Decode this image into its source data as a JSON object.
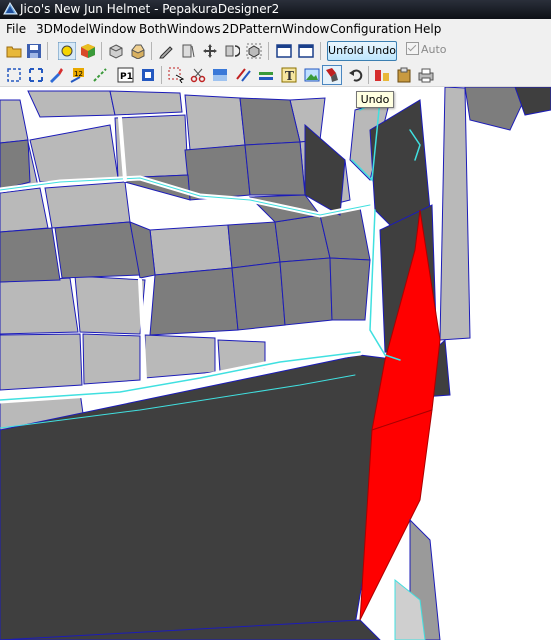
{
  "window": {
    "title": "Jico's New Jun Helmet - PepakuraDesigner2"
  },
  "menu": [
    "File",
    "3DModelWindow",
    "BothWindows",
    "2DPatternWindow",
    "Configuration",
    "Help"
  ],
  "toolbar": {
    "unfold_undo_label": "Unfold Undo",
    "auto_label": "Auto",
    "auto_checked": true
  },
  "tooltip": {
    "text": "Undo"
  },
  "colors": {
    "face_light": "#b9b9b9",
    "face_mid": "#7d7d7d",
    "face_dark": "#3f3f3f",
    "edge_blue": "#1c1cb8",
    "edge_cyan": "#40e0e0",
    "highlight_red": "#ff0000"
  },
  "icons": {
    "toolbar_row1": [
      "open-icon",
      "save-icon",
      "view-3d-icon",
      "color-cube-icon",
      "box-icon",
      "box-open-icon",
      "pencil-icon",
      "crop-icon",
      "move-icon",
      "rotate-icon",
      "cube-select-icon",
      "window-single-icon",
      "window-split-icon"
    ],
    "toolbar_row2": [
      "select-rect-icon",
      "fit-icon",
      "paint-icon",
      "number-icon",
      "edge-icon",
      "page-icon",
      "flag-icon",
      "select-arrow-icon",
      "cut-icon",
      "fill-icon",
      "stripe-icon",
      "line-icon",
      "text-icon",
      "image-icon",
      "undo-arrow-icon",
      "undo-icon",
      "arrange-icon",
      "clipboard-icon",
      "print-icon"
    ]
  }
}
